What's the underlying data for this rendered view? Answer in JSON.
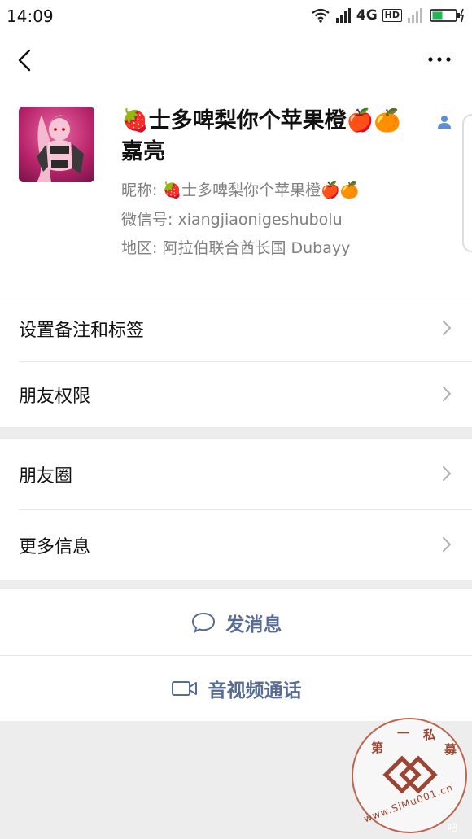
{
  "status_bar": {
    "time": "14:09",
    "network": "4G",
    "hd_badge": "HD",
    "battery_color": "#1db954"
  },
  "nav": {
    "back_icon": "chevron-left-icon",
    "more_icon": "more-dots-icon"
  },
  "profile": {
    "name_line1": "🍓士多啤梨你个苹果橙🍎🍊",
    "name_line2": "嘉亮",
    "nickname_label": "昵称: ",
    "nickname_value": "🍓士多啤梨你个苹果橙🍎🍊",
    "wechat_id_label": "微信号: ",
    "wechat_id_value": "xiangjiaonigeshubolu",
    "region_label": "地区: ",
    "region_value": "阿拉伯联合酋长国  Dubayy",
    "badge_icon": "user-icon",
    "badge_color": "#5a8fd6"
  },
  "menu": {
    "remark_tags": "设置备注和标签",
    "friend_permissions": "朋友权限",
    "moments": "朋友圈",
    "more_info": "更多信息"
  },
  "actions": {
    "send_message": "发消息",
    "video_call": "音视频通话",
    "accent_color": "#576b95"
  },
  "watermark": {
    "chars": [
      "第",
      "一",
      "私",
      "募"
    ],
    "url": "www.SiMu001.cn",
    "suffix": "吧"
  }
}
